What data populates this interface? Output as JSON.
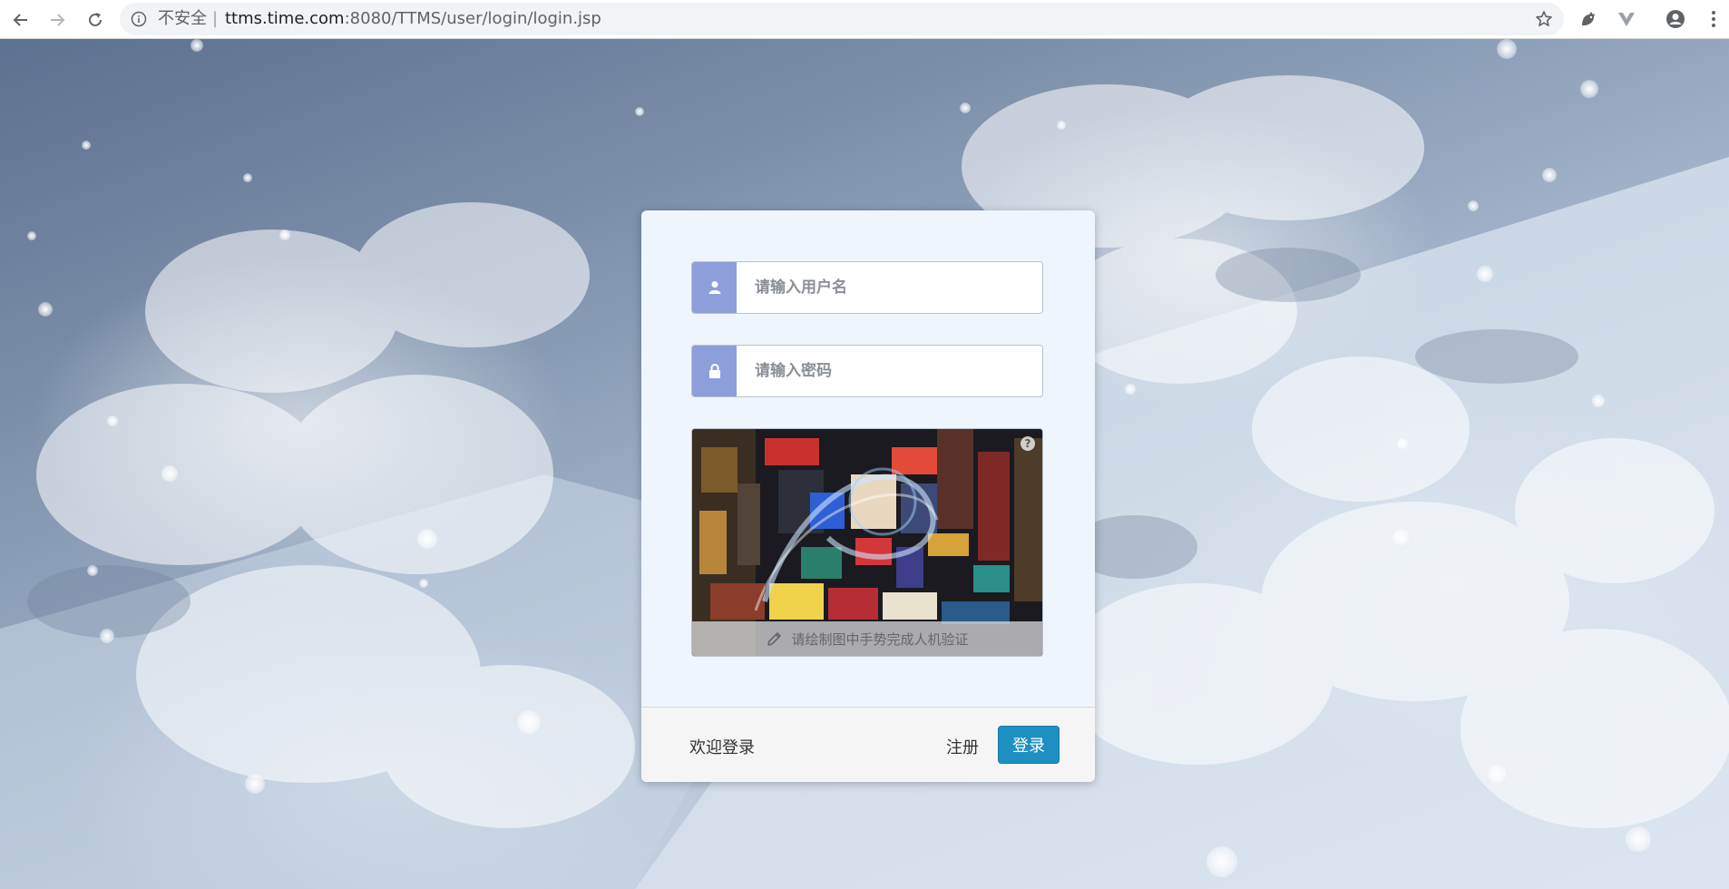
{
  "browser": {
    "security_label": "不安全",
    "separator": "|",
    "url_host": "ttms.time.com",
    "url_rest": ":8080/TTMS/user/login/login.jsp",
    "icons": [
      "back-arrow-icon",
      "forward-arrow-icon",
      "reload-icon",
      "info-icon",
      "bookmark-star-icon",
      "extension-icon",
      "extension-icon",
      "account-icon",
      "menu-icon"
    ]
  },
  "login": {
    "username_placeholder": "请输入用户名",
    "password_placeholder": "请输入密码",
    "captcha_hint": "请绘制图中手势完成人机验证",
    "captcha_help": "?",
    "welcome_text": "欢迎登录",
    "register_label": "注册",
    "login_label": "登录"
  },
  "colors": {
    "addon_bg": "#8c9fda",
    "login_button": "#1d8fc1",
    "panel_bg": "#eef5fc"
  }
}
